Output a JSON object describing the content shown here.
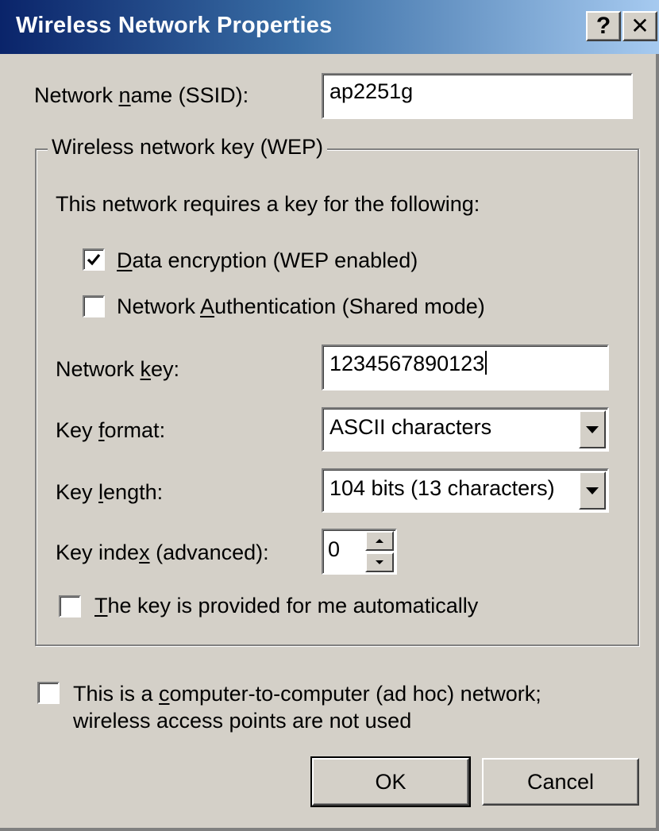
{
  "window": {
    "title": "Wireless Network Properties",
    "help_glyph": "?",
    "close_glyph": "✕"
  },
  "ssid": {
    "label_pre": "Network ",
    "label_u": "n",
    "label_post": "ame (SSID):",
    "value": "ap2251g"
  },
  "wep_group": {
    "legend": "Wireless network key (WEP)",
    "intro": "This network requires a key for the following:",
    "data_encryption": {
      "checked": true,
      "label_u": "D",
      "label_post": "ata encryption (WEP enabled)"
    },
    "network_auth": {
      "checked": false,
      "label_pre": "Network ",
      "label_u": "A",
      "label_post": "uthentication (Shared mode)"
    },
    "network_key": {
      "label_pre": "Network ",
      "label_u": "k",
      "label_post": "ey:",
      "value": "1234567890123"
    },
    "key_format": {
      "label_pre": "Key ",
      "label_u": "f",
      "label_post": "ormat:",
      "selected": "ASCII characters"
    },
    "key_length": {
      "label_pre": "Key ",
      "label_u": "l",
      "label_post": "ength:",
      "selected": "104 bits (13 characters)"
    },
    "key_index": {
      "label_pre": "Key inde",
      "label_u": "x",
      "label_post": " (advanced):",
      "value": "0"
    },
    "auto_key": {
      "checked": false,
      "label_u": "T",
      "label_post": "he key is provided for me automatically"
    }
  },
  "adhoc": {
    "checked": false,
    "line1_pre": "This is a ",
    "line1_u": "c",
    "line1_post": "omputer-to-computer (ad hoc) network;",
    "line2": "wireless access points are not used"
  },
  "buttons": {
    "ok": "OK",
    "cancel": "Cancel"
  }
}
